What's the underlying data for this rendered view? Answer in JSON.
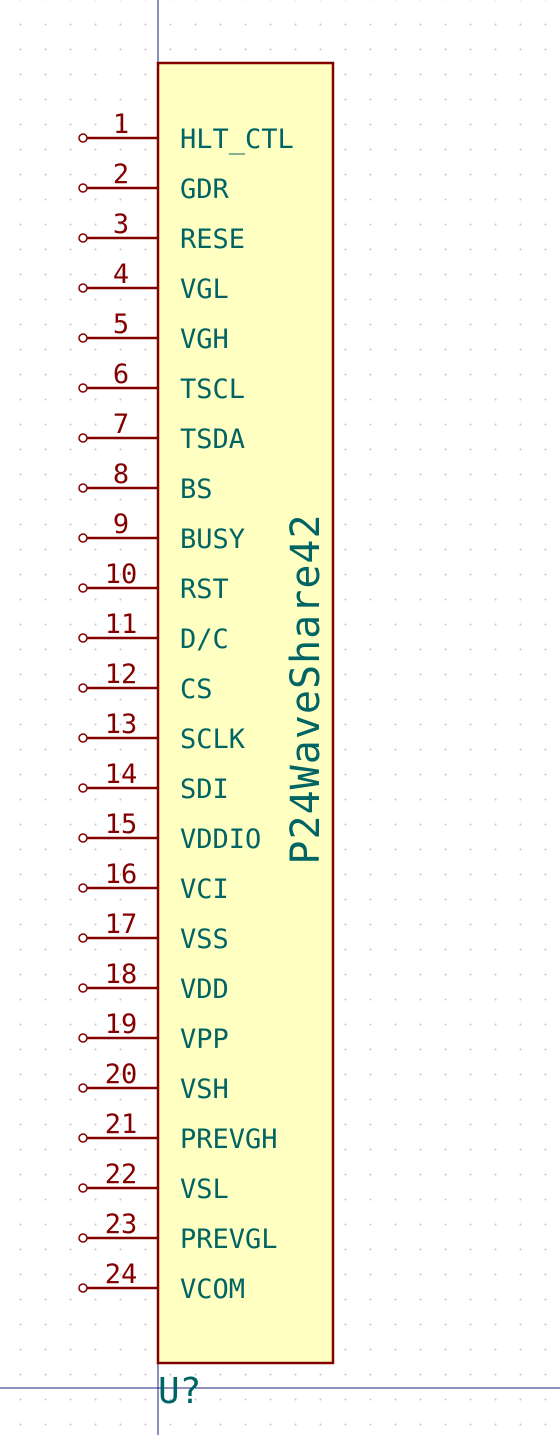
{
  "component": {
    "reference": "U?",
    "value": "P24WaveShare42",
    "body_fill": "#ffffc2",
    "outline_color": "#840000",
    "text_color": "#006464",
    "pins": [
      {
        "number": "1",
        "name": "HLT_CTL"
      },
      {
        "number": "2",
        "name": "GDR"
      },
      {
        "number": "3",
        "name": "RESE"
      },
      {
        "number": "4",
        "name": "VGL"
      },
      {
        "number": "5",
        "name": "VGH"
      },
      {
        "number": "6",
        "name": "TSCL"
      },
      {
        "number": "7",
        "name": "TSDA"
      },
      {
        "number": "8",
        "name": "BS"
      },
      {
        "number": "9",
        "name": "BUSY"
      },
      {
        "number": "10",
        "name": "RST"
      },
      {
        "number": "11",
        "name": "D/C"
      },
      {
        "number": "12",
        "name": "CS"
      },
      {
        "number": "13",
        "name": "SCLK"
      },
      {
        "number": "14",
        "name": "SDI"
      },
      {
        "number": "15",
        "name": "VDDIO"
      },
      {
        "number": "16",
        "name": "VCI"
      },
      {
        "number": "17",
        "name": "VSS"
      },
      {
        "number": "18",
        "name": "VDD"
      },
      {
        "number": "19",
        "name": "VPP"
      },
      {
        "number": "20",
        "name": "VSH"
      },
      {
        "number": "21",
        "name": "PREVGH"
      },
      {
        "number": "22",
        "name": "VSL"
      },
      {
        "number": "23",
        "name": "PREVGL"
      },
      {
        "number": "24",
        "name": "VCOM"
      }
    ]
  },
  "crosshair_color": "#1a237e"
}
